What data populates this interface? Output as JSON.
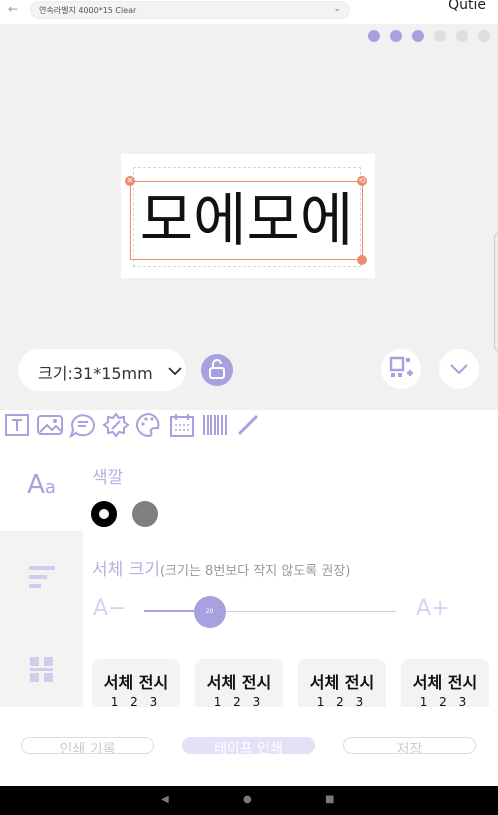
{
  "topbar": {
    "back_icon": "arrow-left-icon",
    "tape_label": "연속라벨지 4000*15 Clear",
    "brand": "Qutie"
  },
  "canvas": {
    "text": "모에모에"
  },
  "size": {
    "label": "크기:31*15mm"
  },
  "panel": {
    "color_title": "색깔",
    "colors": [
      "#000000",
      "#7f7f7f"
    ],
    "font_size_title": "서체 크기",
    "font_size_note": "(크기는 8번보다 작지 않도록 권장)",
    "a_minus": "A−",
    "a_plus": "A+",
    "font_size_value": "20",
    "font_size_fraction": 0.26,
    "font_cards": [
      {
        "name": "서체 전시",
        "digits": "1 2 3"
      },
      {
        "name": "서체 전시",
        "digits": "1 2 3"
      },
      {
        "name": "서체 전시",
        "digits": "1 2 3"
      },
      {
        "name": "서체 전시",
        "digits": "1 2 3"
      }
    ]
  },
  "actions": {
    "history": "인쇄 기록",
    "print": "테이프 인쇄",
    "save": "저장"
  },
  "accent": "#a8a1df"
}
